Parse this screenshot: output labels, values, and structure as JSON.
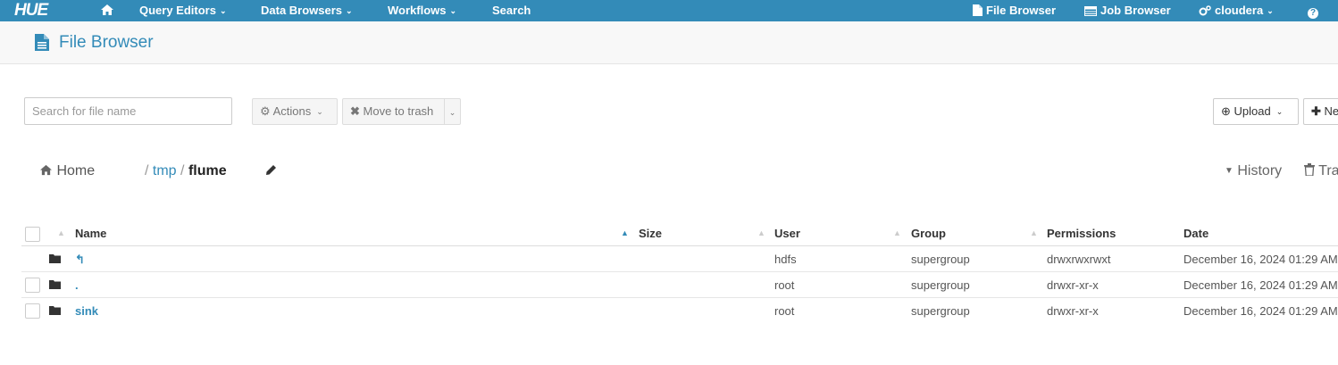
{
  "navbar": {
    "logo": "HUE",
    "items": [
      {
        "label": "Query Editors",
        "caret": "⌄"
      },
      {
        "label": "Data Browsers",
        "caret": "⌄"
      },
      {
        "label": "Workflows",
        "caret": "⌄"
      },
      {
        "label": "Search"
      }
    ],
    "right": {
      "file_browser": "File Browser",
      "job_browser": "Job Browser",
      "user": "cloudera",
      "help": "?"
    }
  },
  "page": {
    "title": "File Browser"
  },
  "toolbar": {
    "search_placeholder": "Search for file name",
    "actions_label": "Actions",
    "move_to_trash_label": "Move to trash",
    "upload_label": "Upload",
    "new_label": "Ne"
  },
  "breadcrumb": {
    "home": "Home",
    "sep1": "/",
    "tmp": "tmp",
    "sep2": "/",
    "current": "flume",
    "history": "History",
    "trash": "Tra"
  },
  "table": {
    "columns": {
      "name": "Name",
      "size": "Size",
      "user": "User",
      "group": "Group",
      "permissions": "Permissions",
      "date": "Date"
    },
    "rows": [
      {
        "name": "↰",
        "size": "",
        "user": "hdfs",
        "group": "supergroup",
        "permissions": "drwxrwxrwxt",
        "date": "December 16, 2024 01:29 AM"
      },
      {
        "name": ".",
        "size": "",
        "user": "root",
        "group": "supergroup",
        "permissions": "drwxr-xr-x",
        "date": "December 16, 2024 01:29 AM"
      },
      {
        "name": "sink",
        "size": "",
        "user": "root",
        "group": "supergroup",
        "permissions": "drwxr-xr-x",
        "date": "December 16, 2024 01:29 AM"
      }
    ]
  },
  "colors": {
    "brand": "#338bb8",
    "title_bar": "#f8f8f8"
  },
  "icons": [
    "home-icon",
    "file-icon",
    "table-icon",
    "cogs-icon",
    "question-icon",
    "document-icon",
    "gear-icon",
    "x-icon",
    "upload-icon",
    "plus-circle-icon",
    "pencil-icon",
    "caret-down-icon",
    "trash-icon",
    "folder-icon",
    "up-arrow-icon",
    "sort-icon"
  ]
}
